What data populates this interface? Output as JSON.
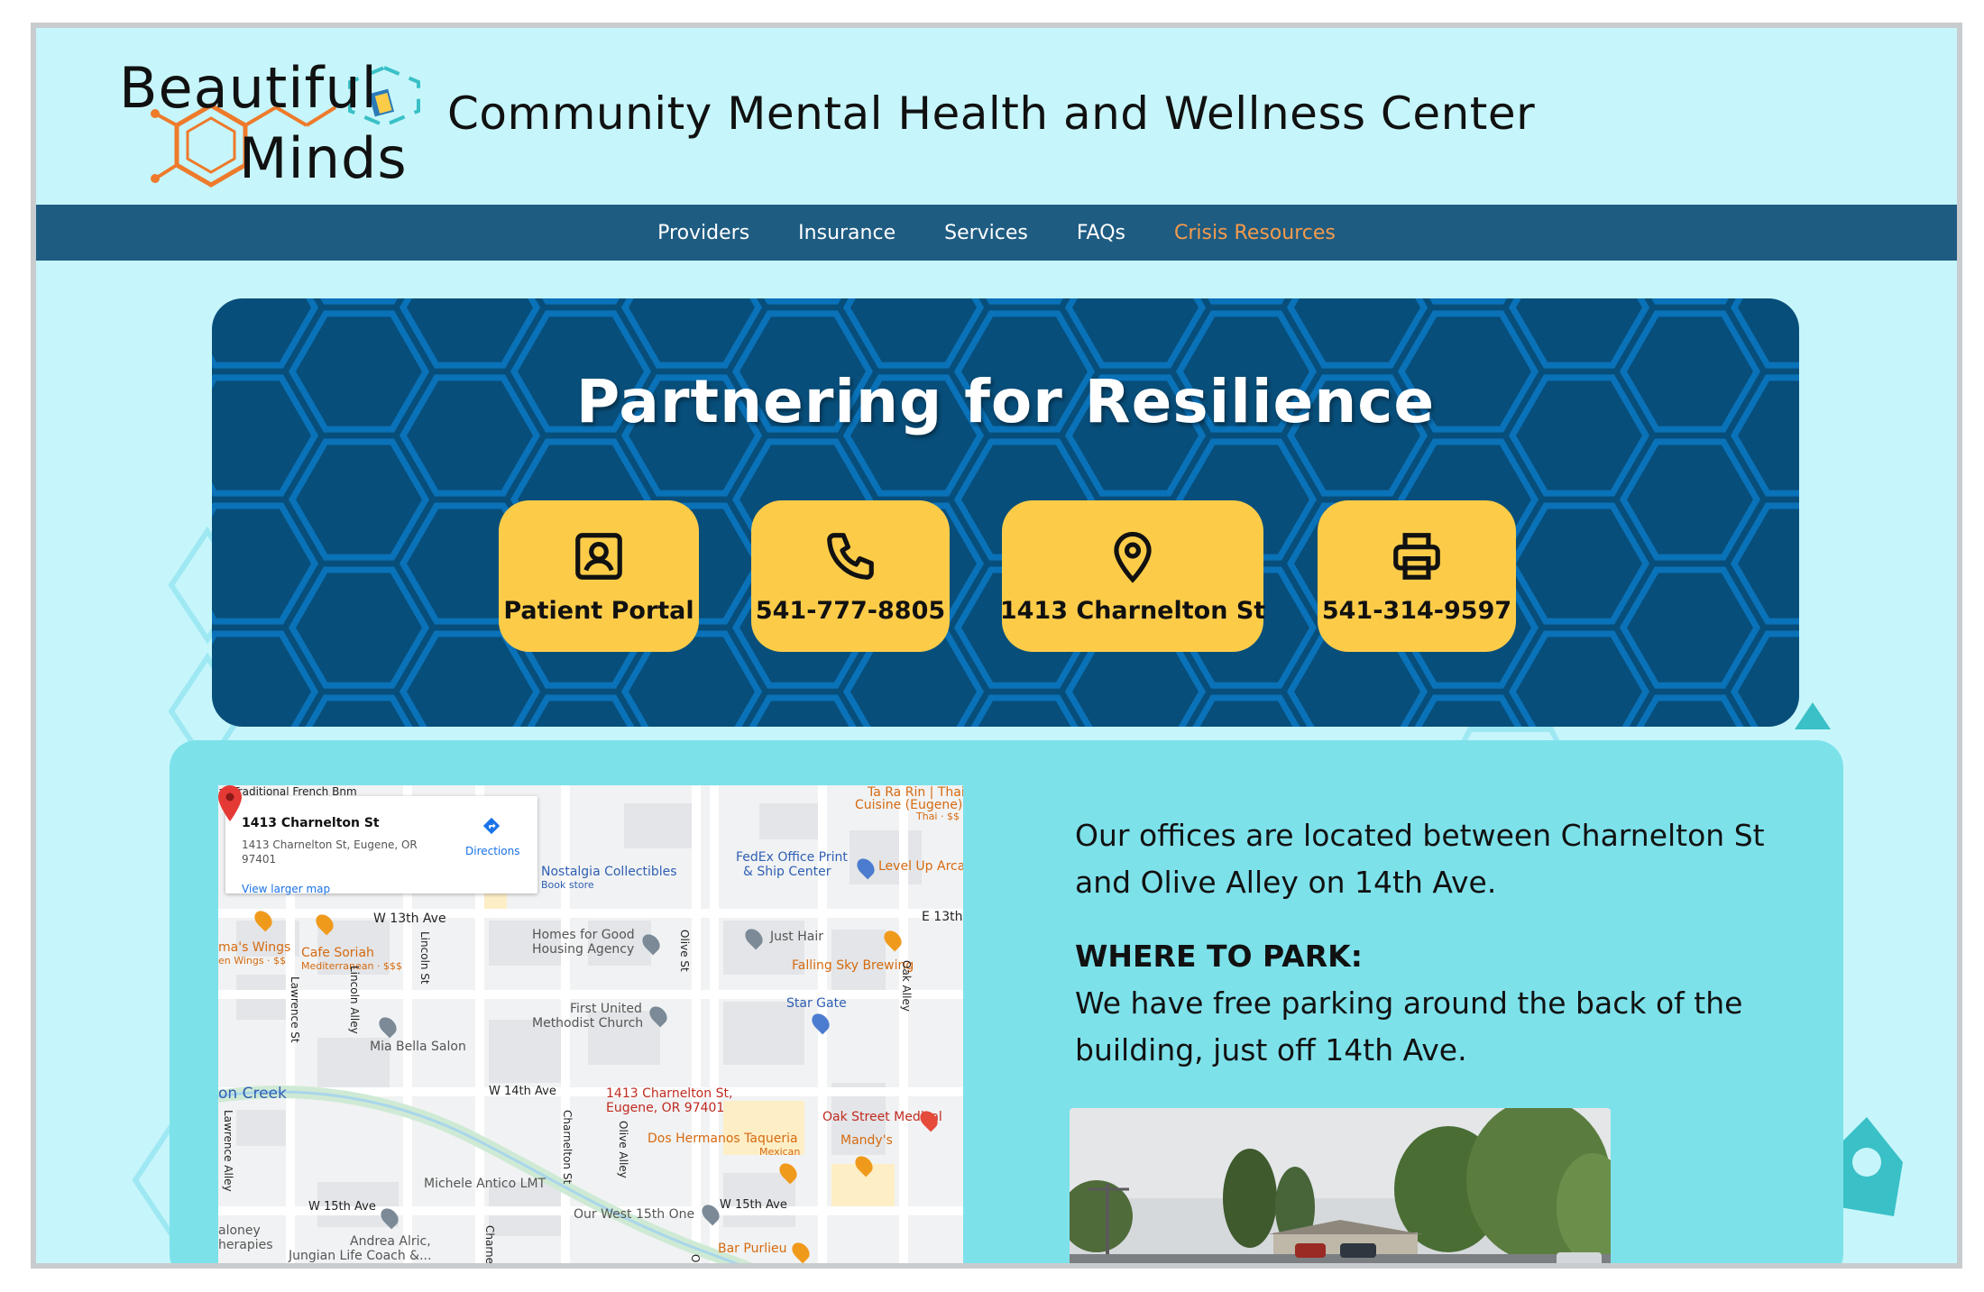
{
  "logo": {
    "line1": "Beautiful",
    "line2": "Minds",
    "accent_orange": "#ee7a2b",
    "accent_teal": "#3ac0c7"
  },
  "header": {
    "title": "Community Mental Health and Wellness Center"
  },
  "nav": {
    "items": [
      {
        "label": "Providers"
      },
      {
        "label": "Insurance"
      },
      {
        "label": "Services"
      },
      {
        "label": "FAQs"
      },
      {
        "label": "Crisis Resources"
      }
    ]
  },
  "hero": {
    "title": "Partnering for Resilience",
    "buttons": [
      {
        "label": "Patient Portal",
        "icon": "contact-card-icon"
      },
      {
        "label": "541-777-8805",
        "icon": "phone-icon"
      },
      {
        "label": "1413 Charnelton St",
        "icon": "location-pin-icon"
      },
      {
        "label": "541-314-9597",
        "icon": "printer-icon"
      }
    ]
  },
  "map": {
    "card_title": "1413 Charnelton St",
    "card_address": "1413 Charnelton St, Eugene, OR 97401",
    "directions": "Directions",
    "larger_map": "View larger map",
    "pin_label_1": "1413 Charnelton St,",
    "pin_label_2": "Eugene, OR 97401",
    "labels": {
      "nostalgia": "Nostalgia Collectibles",
      "book_store": "Book store",
      "fedex": "FedEx Office Print",
      "fedex2": "& Ship Center",
      "level_up": "Level Up Arca",
      "ta_ra_rin": "Ta Ra Rin | Thai",
      "cuisine": "Cuisine (Eugene)",
      "thai": "Thai · $$",
      "w13": "W 13th Ave",
      "e13": "E 13th",
      "wings": "ma's Wings",
      "wings2": "en Wings · $$",
      "cafe": "Cafe Soriah",
      "cafe2": "Mediterranean · $$$",
      "homes": "Homes for Good",
      "homes2": "Housing Agency",
      "just_hair": "Just Hair",
      "falling_sky": "Falling Sky Brewing",
      "first_united": "First United",
      "methodist": "Methodist Church",
      "star_gate": "Star Gate",
      "mia_bella": "Mia Bella Salon",
      "creek": "on Creek",
      "w14": "W 14th Ave",
      "oak_medical": "Oak Street Medical",
      "dos_hermanos": "Dos Hermanos Taqueria",
      "mexican": "Mexican",
      "mandys": "Mandy's",
      "michele": "Michele Antico LMT",
      "w15": "W 15th Ave",
      "w15b": "W 15th Ave",
      "our_west": "Our West 15th One",
      "maloney": "aloney",
      "therapies": "herapies",
      "andrea": "Andrea Alric,",
      "jungian": "Jungian Life Coach &...",
      "bar_purlieu": "Bar Purlieu",
      "lawrence": "Lawrence St",
      "lawrence2": "Lawrence Alley",
      "lincoln_alley": "Lincoln Alley",
      "lincoln": "Lincoln St",
      "olive": "Olive St",
      "olive_alley": "Olive Alley",
      "oak_alley": "Oak Alley",
      "charnelton": "Charnelton St",
      "charnelt": "Charnelt",
      "ar_trad": "ar Traditional French Bnm",
      "olive_short": "Oliv"
    }
  },
  "info": {
    "location_text": "Our offices are located between Charnelton St and Olive Alley on 14th Ave.",
    "park_heading": "WHERE TO PARK:",
    "park_text": "We have free parking around the back of the building, just off 14th Ave."
  },
  "colors": {
    "page_bg": "#c6f6fb",
    "nav_bg": "#1f5c82",
    "crisis": "#f39b4c",
    "hero_bg": "#084e7a",
    "hex_line": "#0a72b8",
    "button_bg": "#fccc49",
    "info_bg": "#7de1ea"
  }
}
